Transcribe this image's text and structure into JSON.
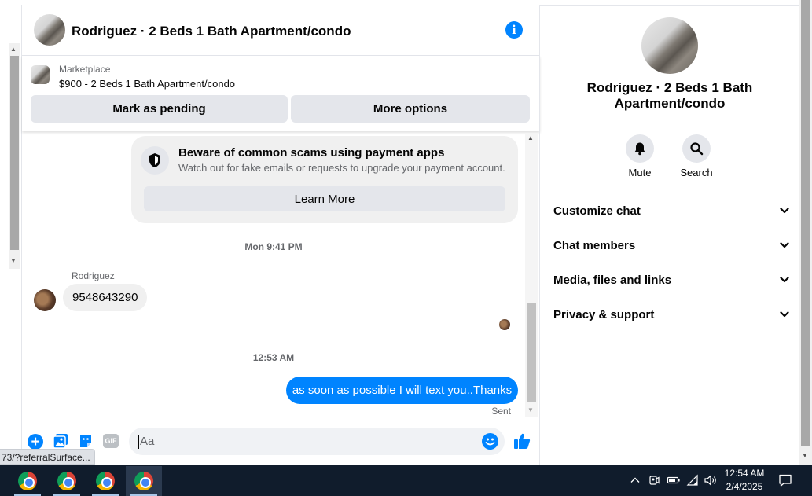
{
  "header": {
    "title": "Rodriguez · 2 Beds 1 Bath Apartment/condo"
  },
  "listing": {
    "category": "Marketplace",
    "price_title": "$900 - 2 Beds 1 Bath Apartment/condo",
    "mark_pending_label": "Mark as pending",
    "more_options_label": "More options"
  },
  "scam_notice": {
    "title": "Beware of common scams using payment apps",
    "body": "Watch out for fake emails or requests to upgrade your payment account.",
    "learn_more_label": "Learn More"
  },
  "messages": {
    "ts1": "Mon 9:41 PM",
    "sender": "Rodriguez",
    "incoming_text": "9548643290",
    "ts2": "12:53 AM",
    "outgoing_text": "as soon as possible I will text you..Thanks",
    "status": "Sent"
  },
  "composer": {
    "placeholder": "Aa",
    "gif_label": "GIF"
  },
  "status_url": "73/?referralSurface...",
  "right_panel": {
    "title": "Rodriguez · 2 Beds 1 Bath Apartment/condo",
    "mute_label": "Mute",
    "search_label": "Search",
    "menu": [
      {
        "label": "Customize chat"
      },
      {
        "label": "Chat members"
      },
      {
        "label": "Media, files and links"
      },
      {
        "label": "Privacy & support"
      }
    ]
  },
  "taskbar": {
    "time": "12:54 AM",
    "date": "2/4/2025"
  },
  "colors": {
    "accent": "#0084ff",
    "taskbar": "#101c2c",
    "grey_button": "#e4e6eb"
  }
}
